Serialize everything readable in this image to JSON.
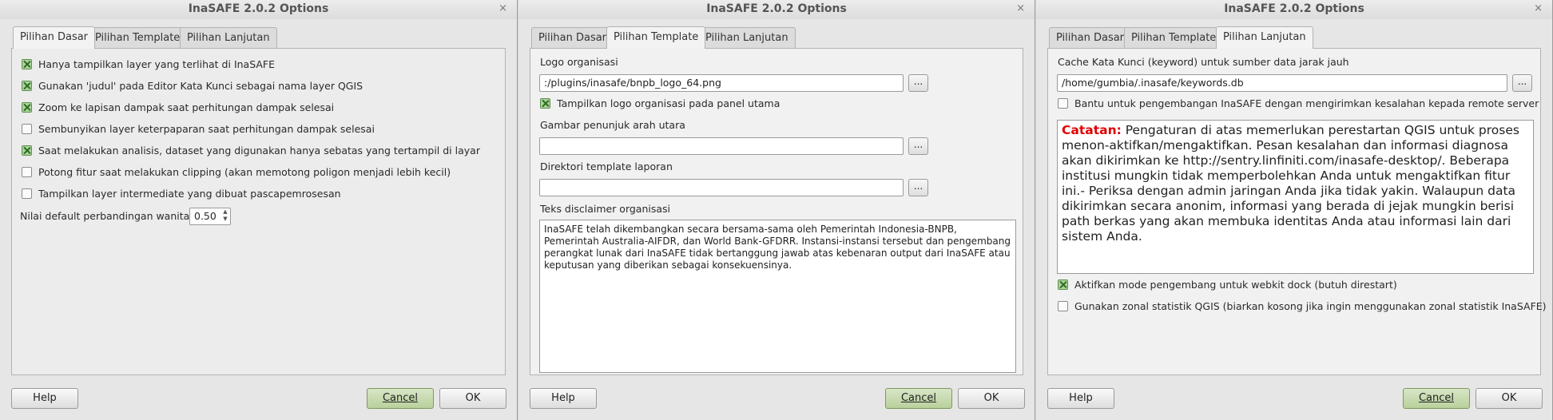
{
  "window_title": "InaSAFE 2.0.2 Options",
  "close_glyph": "×",
  "tabs": [
    "Pilihan Dasar",
    "Pilihan Template",
    "Pilihan Lanjutan"
  ],
  "buttons": {
    "help": "Help",
    "cancel": "Cancel",
    "ok": "OK"
  },
  "basic": {
    "options": [
      {
        "label": "Hanya tampilkan layer yang terlihat di InaSAFE",
        "checked": true
      },
      {
        "label": "Gunakan 'judul' pada Editor Kata Kunci sebagai nama layer QGIS",
        "checked": true
      },
      {
        "label": "Zoom ke lapisan dampak saat perhitungan dampak selesai",
        "checked": true
      },
      {
        "label": "Sembunyikan layer keterpaparan saat perhitungan dampak selesai",
        "checked": false
      },
      {
        "label": "Saat melakukan analisis, dataset yang digunakan hanya sebatas yang tertampil di layar",
        "checked": true
      },
      {
        "label": "Potong fitur saat melakukan clipping (akan memotong poligon menjadi lebih kecil)",
        "checked": false
      },
      {
        "label": "Tampilkan layer intermediate yang dibuat pascapemrosesan",
        "checked": false
      }
    ],
    "female_ratio_label": "Nilai default perbandingan wanita",
    "female_ratio_value": "0.50"
  },
  "template": {
    "logo_label": "Logo organisasi",
    "logo_path": ":/plugins/inasafe/bnpb_logo_64.png",
    "show_logo_label": "Tampilkan logo organisasi pada panel utama",
    "show_logo_checked": true,
    "north_arrow_label": "Gambar penunjuk arah utara",
    "north_arrow_value": "",
    "template_dir_label": "Direktori template laporan",
    "template_dir_value": "",
    "disclaimer_label": "Teks disclaimer organisasi",
    "disclaimer_text": "InaSAFE telah dikembangkan secara bersama-sama oleh Pemerintah Indonesia-BNPB, Pemerintah Australia-AIFDR, dan World Bank-GFDRR. Instansi-instansi tersebut dan pengembang perangkat lunak dari InaSAFE tidak bertanggung jawab atas kebenaran output dari InaSAFE atau keputusan yang diberikan sebagai konsekuensinya.",
    "browse_label": "..."
  },
  "advanced": {
    "cache_label": "Cache Kata Kunci (keyword) untuk sumber data jarak jauh",
    "cache_path": "/home/gumbia/.inasafe/keywords.db",
    "bug_report_label": "Bantu untuk pengembangan InaSAFE dengan mengirimkan kesalahan kepada remote server",
    "bug_report_checked": false,
    "note_title": "Catatan:",
    "note_text": " Pengaturan di atas memerlukan perestartan QGIS untuk proses menon-aktifkan/mengaktifkan. Pesan kesalahan dan informasi diagnosa akan dikirimkan ke http://sentry.linfiniti.com/inasafe-desktop/. Beberapa institusi mungkin tidak memperbolehkan Anda untuk mengaktifkan fitur ini.- Periksa dengan admin jaringan Anda jika tidak yakin. Walaupun data dikirimkan secara anonim, informasi yang berada di jejak mungkin berisi path berkas yang akan membuka identitas Anda atau informasi lain dari sistem Anda.",
    "dev_mode_label": "Aktifkan mode pengembang untuk webkit dock (butuh direstart)",
    "dev_mode_checked": true,
    "zonal_label": "Gunakan zonal statistik QGIS (biarkan kosong jika ingin menggunakan zonal statistik InaSAFE)",
    "zonal_checked": false,
    "browse_label": "..."
  }
}
